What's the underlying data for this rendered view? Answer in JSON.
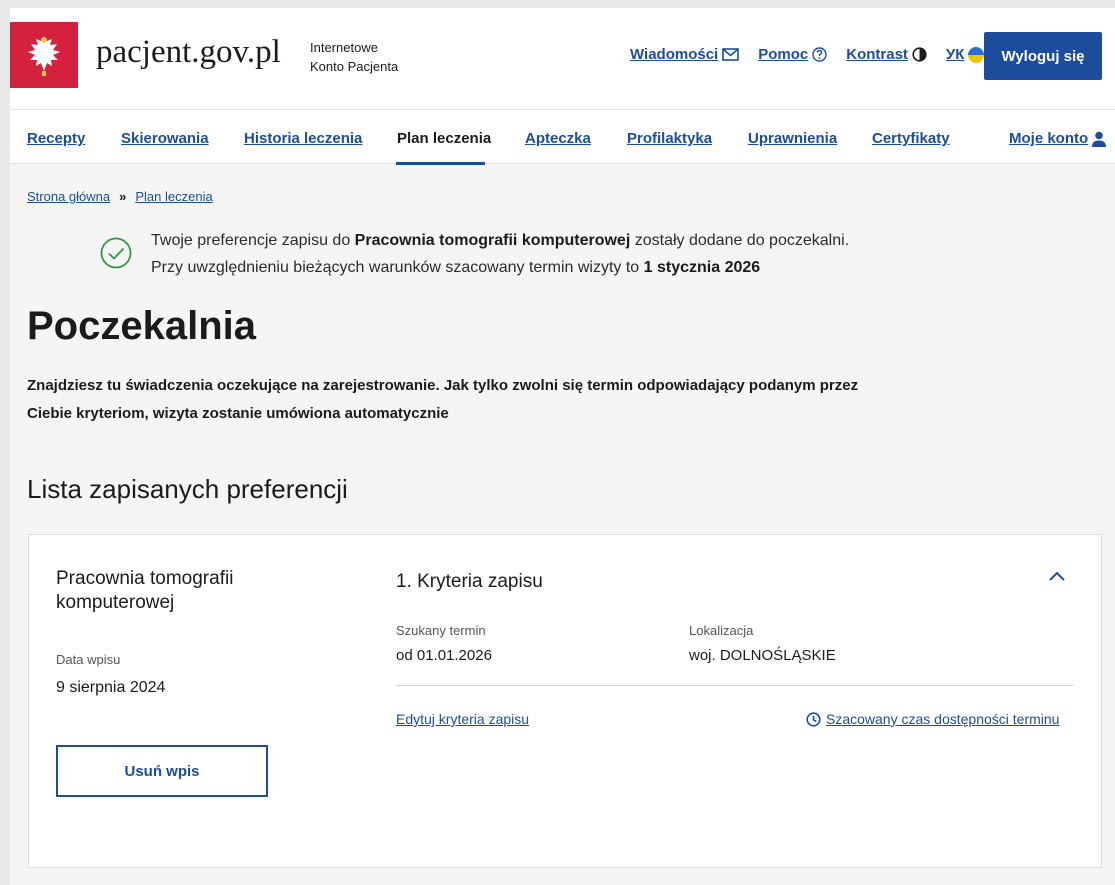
{
  "header": {
    "brand": "pacjent.gov.pl",
    "brand_sub_line1": "Internetowe",
    "brand_sub_line2": "Konto Pacjenta",
    "links": {
      "messages": "Wiadomości",
      "help": "Pomoc",
      "contrast": "Kontrast",
      "language": "УК"
    },
    "logout": "Wyloguj się"
  },
  "nav": {
    "items": [
      "Recepty",
      "Skierowania",
      "Historia leczenia",
      "Plan leczenia",
      "Apteczka",
      "Profilaktyka",
      "Uprawnienia",
      "Certyfikaty"
    ],
    "account": "Moje konto",
    "active": "Plan leczenia"
  },
  "breadcrumb": {
    "home": "Strona główna",
    "separator": "»",
    "current": "Plan leczenia"
  },
  "alert": {
    "line1_prefix": "Twoje preferencje zapisu do ",
    "line1_bold": "Pracownia tomografii komputerowej",
    "line1_suffix": " zostały dodane do poczekalni.",
    "line2_prefix": "Przy uwzględnieniu bieżących warunków szacowany termin wizyty to ",
    "line2_bold": "1 stycznia 2026"
  },
  "main": {
    "title": "Poczekalnia",
    "intro": "Znajdziesz tu świadczenia oczekujące na zarejestrowanie. Jak tylko zwolni się termin odpowiadający podanym przez Ciebie kryteriom, wizyta zostanie umówiona automatycznie",
    "list_title": "Lista zapisanych preferencji"
  },
  "card": {
    "service": "Pracownia tomografii komputerowej",
    "entry_date_label": "Data wpisu",
    "entry_date": "9 sierpnia 2024",
    "remove_button": "Usuń wpis",
    "criteria_title": "1. Kryteria zapisu",
    "term_label": "Szukany termin",
    "term_value": "od 01.01.2026",
    "location_label": "Lokalizacja",
    "location_value": "woj. DOLNOŚLĄSKIE",
    "edit_link": "Edytuj kryteria zapisu",
    "estimate_link": "Szacowany czas dostępności terminu"
  },
  "colors": {
    "primary": "#1c4d9c",
    "success": "#2e9a3e",
    "gov_red": "#d4213d"
  }
}
